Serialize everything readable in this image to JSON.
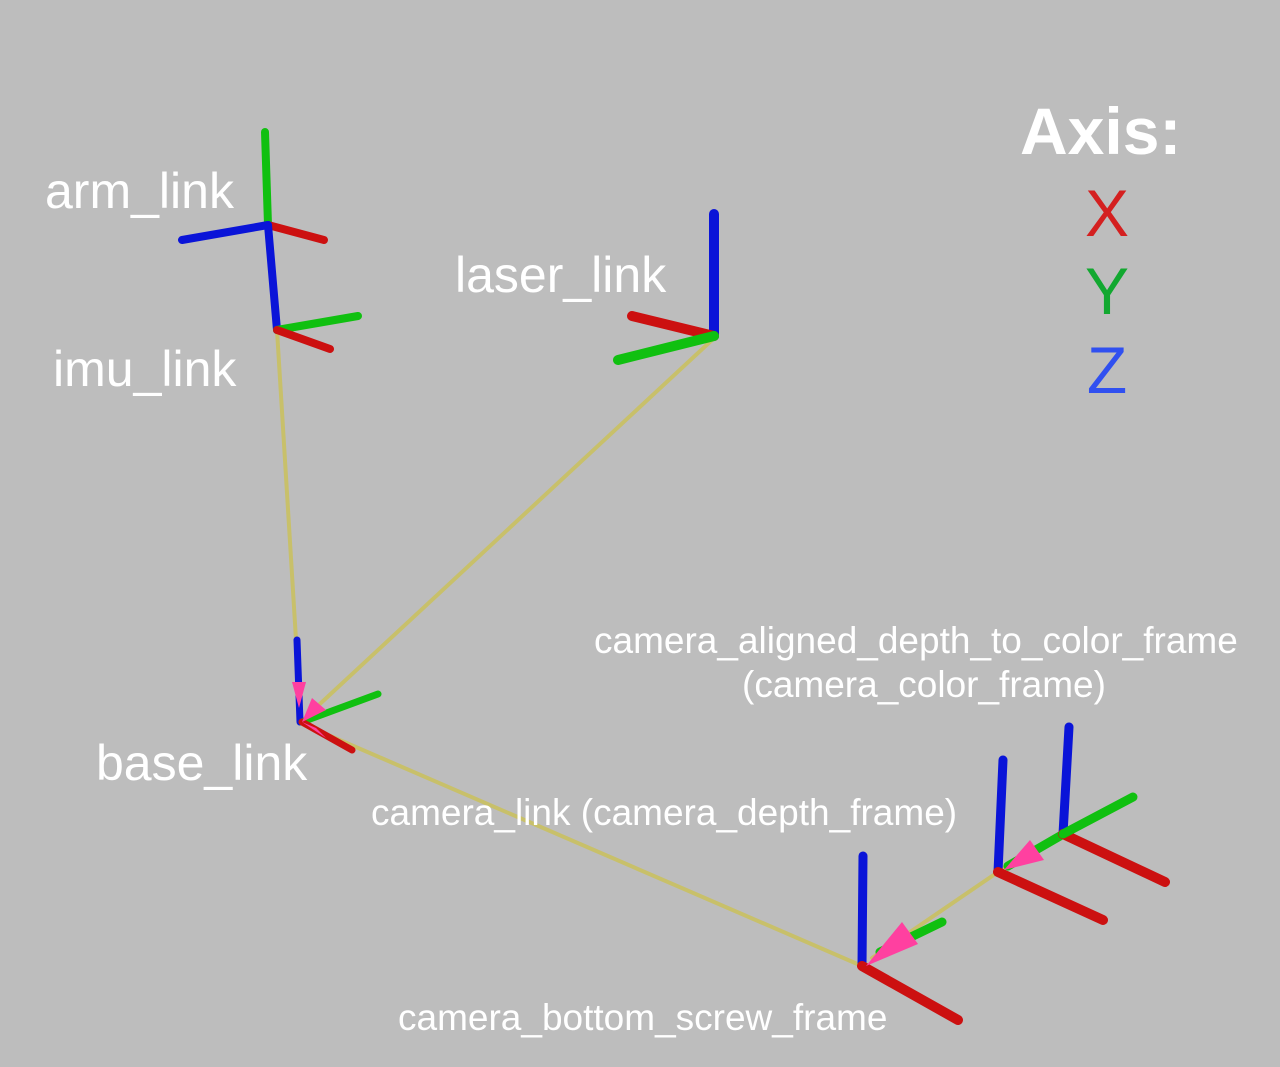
{
  "frames": [
    {
      "id": "arm_link",
      "label": "arm_link"
    },
    {
      "id": "imu_link",
      "label": "imu_link"
    },
    {
      "id": "laser_link",
      "label": "laser_link"
    },
    {
      "id": "base_link",
      "label": "base_link"
    },
    {
      "id": "camera_aligned",
      "label_line1": "camera_aligned_depth_to_color_frame",
      "label_line2": "(camera_color_frame)"
    },
    {
      "id": "camera_link",
      "label": "camera_link (camera_depth_frame)"
    },
    {
      "id": "camera_bottom_screw_frame",
      "label": "camera_bottom_screw_frame"
    }
  ],
  "legend": {
    "title": "Axis:",
    "x": {
      "label": "X",
      "color": "#d42020"
    },
    "y": {
      "label": "Y",
      "color": "#12a830"
    },
    "z": {
      "label": "Z",
      "color": "#3050f0"
    }
  },
  "colors": {
    "x_axis": "#cc1010",
    "y_axis": "#10c010",
    "z_axis": "#0a14d8",
    "link": "#c8c06a",
    "arrow": "#ff40a0",
    "background": "#bdbdbd"
  }
}
